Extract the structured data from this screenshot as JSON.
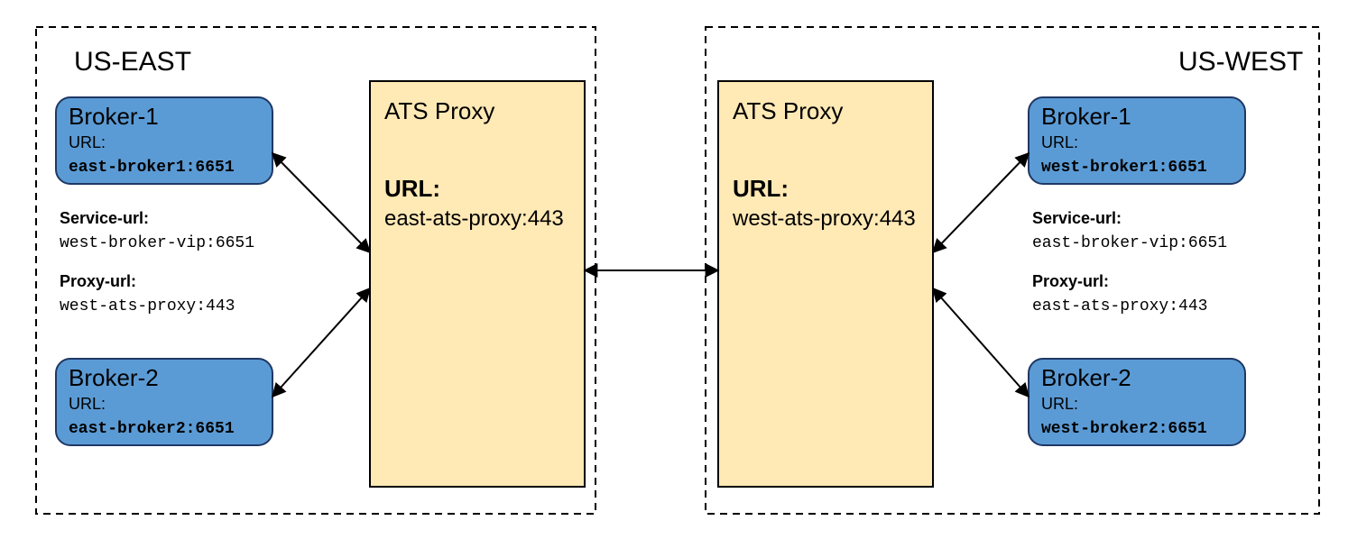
{
  "colors": {
    "broker_fill": "#5b9bd5",
    "broker_stroke": "#1f3864",
    "proxy_fill": "#ffe9b5",
    "proxy_stroke": "#000000",
    "region_stroke": "#000000"
  },
  "east": {
    "title": "US-EAST",
    "broker1": {
      "name": "Broker-1",
      "url_label": "URL:",
      "url": "east-broker1:6651"
    },
    "broker2": {
      "name": "Broker-2",
      "url_label": "URL:",
      "url": "east-broker2:6651"
    },
    "service_url_label": "Service-url:",
    "service_url": "west-broker-vip:6651",
    "proxy_url_label": "Proxy-url:",
    "proxy_url": "west-ats-proxy:443",
    "ats": {
      "title": "ATS Proxy",
      "url_label": "URL:",
      "url": "east-ats-proxy:443"
    }
  },
  "west": {
    "title": "US-WEST",
    "broker1": {
      "name": "Broker-1",
      "url_label": "URL:",
      "url": "west-broker1:6651"
    },
    "broker2": {
      "name": "Broker-2",
      "url_label": "URL:",
      "url": "west-broker2:6651"
    },
    "service_url_label": "Service-url:",
    "service_url": "east-broker-vip:6651",
    "proxy_url_label": "Proxy-url:",
    "proxy_url": "east-ats-proxy:443",
    "ats": {
      "title": "ATS Proxy",
      "url_label": "URL:",
      "url": "west-ats-proxy:443"
    }
  }
}
